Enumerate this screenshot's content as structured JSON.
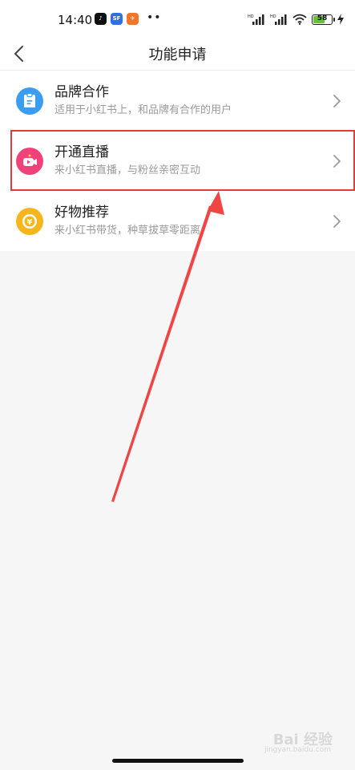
{
  "status_bar": {
    "time": "14:40",
    "battery_level": "58",
    "app_badges": [
      {
        "name": "tiktok",
        "text": "♪",
        "color": "#111111"
      },
      {
        "name": "app-blue",
        "text": "SF",
        "color": "#2f6ee8"
      },
      {
        "name": "app-orange",
        "text": "✈",
        "color": "#f0762a"
      }
    ],
    "more_indicator": "••"
  },
  "nav": {
    "title": "功能申请"
  },
  "items": [
    {
      "title": "品牌合作",
      "subtitle": "适用于小红书上，和品牌有合作的用户",
      "icon": "brand-cooperation-icon",
      "color": "#3b9df0"
    },
    {
      "title": "开通直播",
      "subtitle": "来小红书直播，与粉丝亲密互动",
      "icon": "live-stream-icon",
      "color": "#f0427a"
    },
    {
      "title": "好物推荐",
      "subtitle": "来小红书带货，种草拔草零距离",
      "icon": "product-recommend-icon",
      "color": "#f6b51c"
    }
  ],
  "colors": {
    "highlight": "#e83a3a",
    "arrow": "#f04545"
  },
  "watermark": {
    "text": "Bai 经验",
    "sub": "jingyan.baidu.com"
  }
}
